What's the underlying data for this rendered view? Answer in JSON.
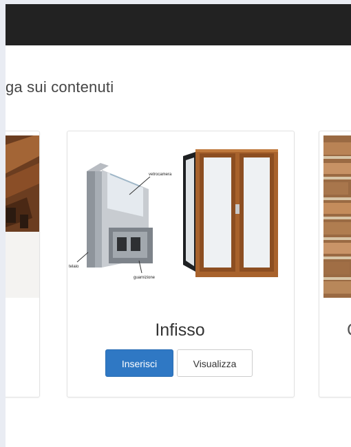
{
  "section": {
    "title": "ga sui contenuti"
  },
  "card": {
    "title": "Infisso",
    "insert_label": "Inserisci",
    "view_label": "Visualizza",
    "diagram_labels": {
      "glass": "vetrocamera",
      "frame": "telaio",
      "seal": "guarnizione"
    }
  },
  "right_card": {
    "title_fragment": "C"
  },
  "colors": {
    "navbar": "#222222",
    "primary": "#2f78c4",
    "background": "#e9ecf3"
  }
}
